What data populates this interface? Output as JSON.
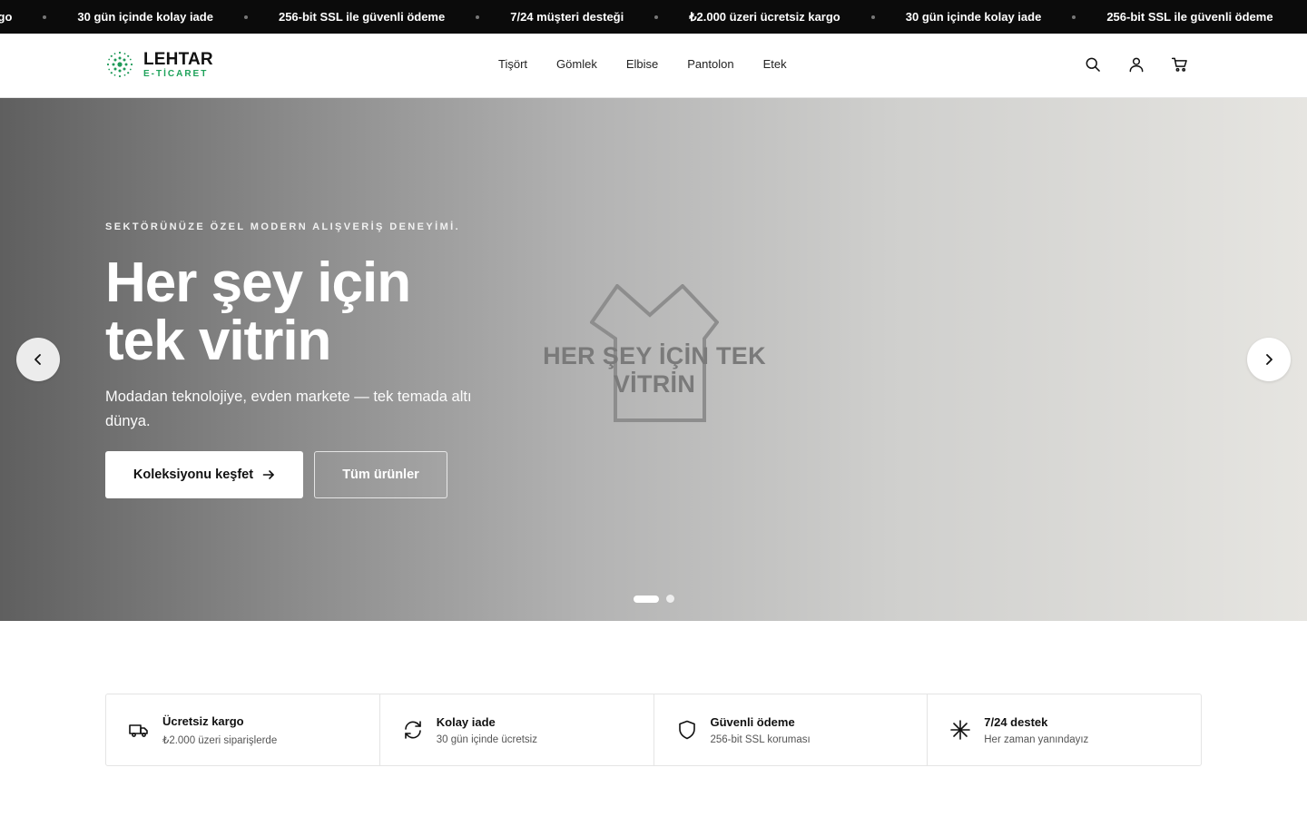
{
  "announcement": {
    "items": [
      "kargo",
      "30 gün içinde kolay iade",
      "256-bit SSL ile güvenli ödeme",
      "7/24 müşteri desteği",
      "₺2.000 üzeri ücretsiz kargo",
      "30 gün içinde kolay iade",
      "256-bit SSL ile güvenli ödeme"
    ]
  },
  "brand": {
    "name": "LEHTAR",
    "tagline": "E-TİCARET",
    "accent": "#1ea25a"
  },
  "nav": {
    "items": [
      "Tişört",
      "Gömlek",
      "Elbise",
      "Pantolon",
      "Etek"
    ]
  },
  "header_icons": [
    "search-icon",
    "user-icon",
    "cart-icon"
  ],
  "hero": {
    "eyebrow": "SEKTÖRÜNÜZE ÖZEL MODERN ALIŞVERİŞ DENEYİMİ.",
    "title_line1": "Her şey için",
    "title_line2": "tek vitrin",
    "description": "Modadan teknolojiye, evden markete — tek temada altı dünya.",
    "image_text": "HER ŞEY İÇİN TEK VİTRİN",
    "primary_cta": "Koleksiyonu keşfet",
    "secondary_cta": "Tüm ürünler",
    "slides_total": 2,
    "active_slide": 1
  },
  "features": [
    {
      "icon": "truck-icon",
      "title": "Ücretsiz kargo",
      "subtitle": "₺2.000 üzeri siparişlerde"
    },
    {
      "icon": "refresh-icon",
      "title": "Kolay iade",
      "subtitle": "30 gün içinde ücretsiz"
    },
    {
      "icon": "shield-icon",
      "title": "Güvenli ödeme",
      "subtitle": "256-bit SSL koruması"
    },
    {
      "icon": "asterisk-icon",
      "title": "7/24 destek",
      "subtitle": "Her zaman yanındayız"
    }
  ]
}
